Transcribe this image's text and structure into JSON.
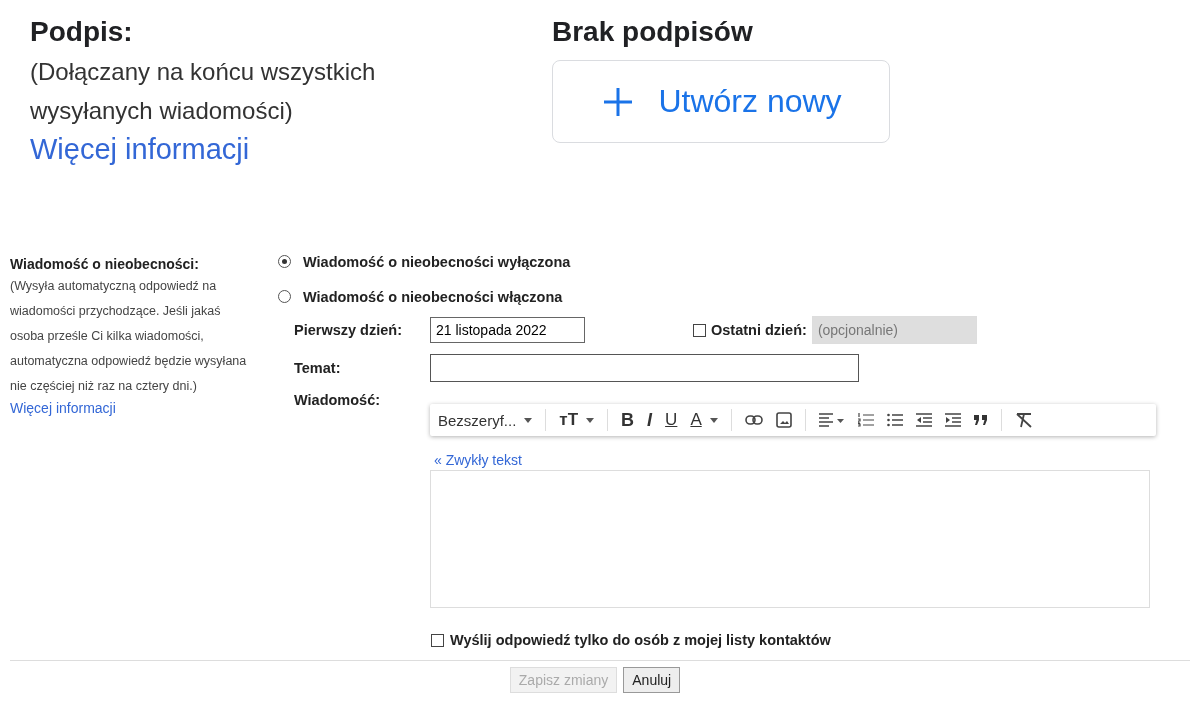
{
  "signature": {
    "title": "Podpis:",
    "description": "(Dołączany na końcu wszystkich wysyłanych wiadomości)",
    "link": "Więcej informacji",
    "status": "Brak podpisów",
    "create_button": "Utwórz nowy"
  },
  "vacation": {
    "label": "Wiadomość o nieobecności:",
    "description": "(Wysyła automatyczną odpowiedź na wiadomości przychodzące. Jeśli jakaś osoba prześle Ci kilka wiadomości, automatyczna odpowiedź będzie wysyłana nie częściej niż raz na cztery dni.)",
    "link": "Więcej informacji",
    "options": [
      {
        "label": "Wiadomość o nieobecności wyłączona",
        "selected": true
      },
      {
        "label": "Wiadomość o nieobecności włączona",
        "selected": false
      }
    ],
    "first_day": {
      "label": "Pierwszy dzień:",
      "value": "21 listopada 2022"
    },
    "last_day": {
      "label": "Ostatni dzień:",
      "checked": false,
      "placeholder": "(opcjonalnie)",
      "disabled": true
    },
    "subject": {
      "label": "Temat:"
    },
    "message": {
      "label": "Wiadomość:",
      "toolbar": [
        {
          "kind": "font",
          "label": "Bezszeryf..."
        },
        {
          "kind": "size",
          "label": "тT"
        },
        {
          "kind": "bold",
          "label": "B"
        },
        {
          "kind": "italic",
          "label": "I"
        },
        {
          "kind": "underline",
          "label": "U"
        },
        {
          "kind": "color",
          "label": "A"
        },
        {
          "kind": "link"
        },
        {
          "kind": "image"
        },
        {
          "kind": "align"
        },
        {
          "kind": "numbered"
        },
        {
          "kind": "bulleted"
        },
        {
          "kind": "outdent"
        },
        {
          "kind": "indent"
        },
        {
          "kind": "quote"
        },
        {
          "kind": "clear"
        }
      ],
      "plain_text_link": "« Zwykły tekst"
    },
    "contacts_only": {
      "label": "Wyślij odpowiedź tylko do osób z mojej listy kontaktów",
      "checked": false
    },
    "buttons": [
      {
        "label": "Zapisz zmiany",
        "disabled": true
      },
      {
        "label": "Anuluj",
        "disabled": false
      }
    ]
  }
}
